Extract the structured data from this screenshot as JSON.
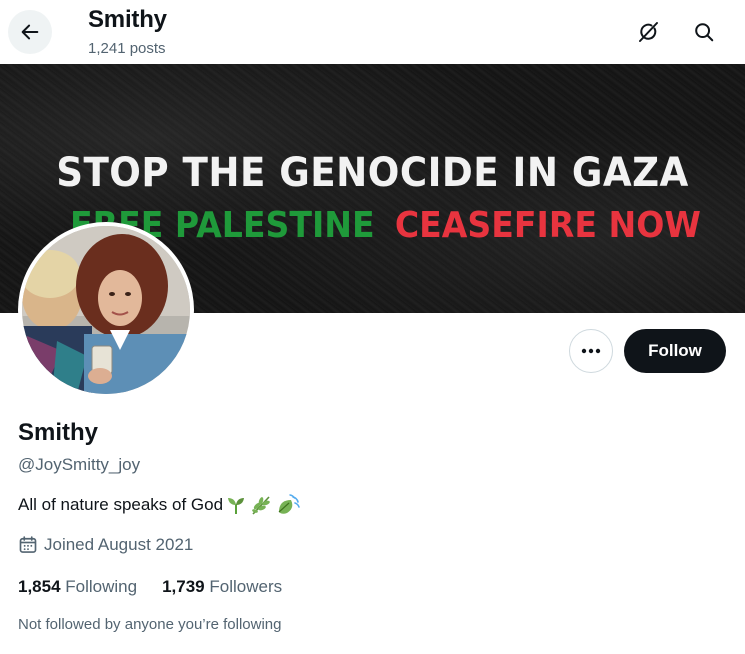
{
  "header": {
    "title": "Smithy",
    "posts_count": "1,241 posts",
    "back_icon": "arrow-left-icon",
    "grok_icon": "grok-icon",
    "search_icon": "search-icon"
  },
  "banner": {
    "line1": "STOP THE GENOCIDE IN GAZA",
    "line2_green": "FREE PALESTINE",
    "line2_red": "CEASEFIRE NOW",
    "colors": {
      "green": "#1f9a3a",
      "red": "#e8343f",
      "background": "#161616"
    }
  },
  "actions": {
    "more_icon": "more-horizontal-icon",
    "follow_label": "Follow"
  },
  "profile": {
    "display_name": "Smithy",
    "handle": "@JoySmitty_joy",
    "bio": "All of nature speaks of God",
    "bio_emojis": [
      "seedling-emoji",
      "herb-emoji",
      "leaf-fluttering-emoji"
    ],
    "joined_icon": "calendar-icon",
    "joined": "Joined August 2021",
    "following_count": "1,854",
    "following_label": "Following",
    "followers_count": "1,739",
    "followers_label": "Followers",
    "not_followed": "Not followed by anyone you’re following"
  }
}
